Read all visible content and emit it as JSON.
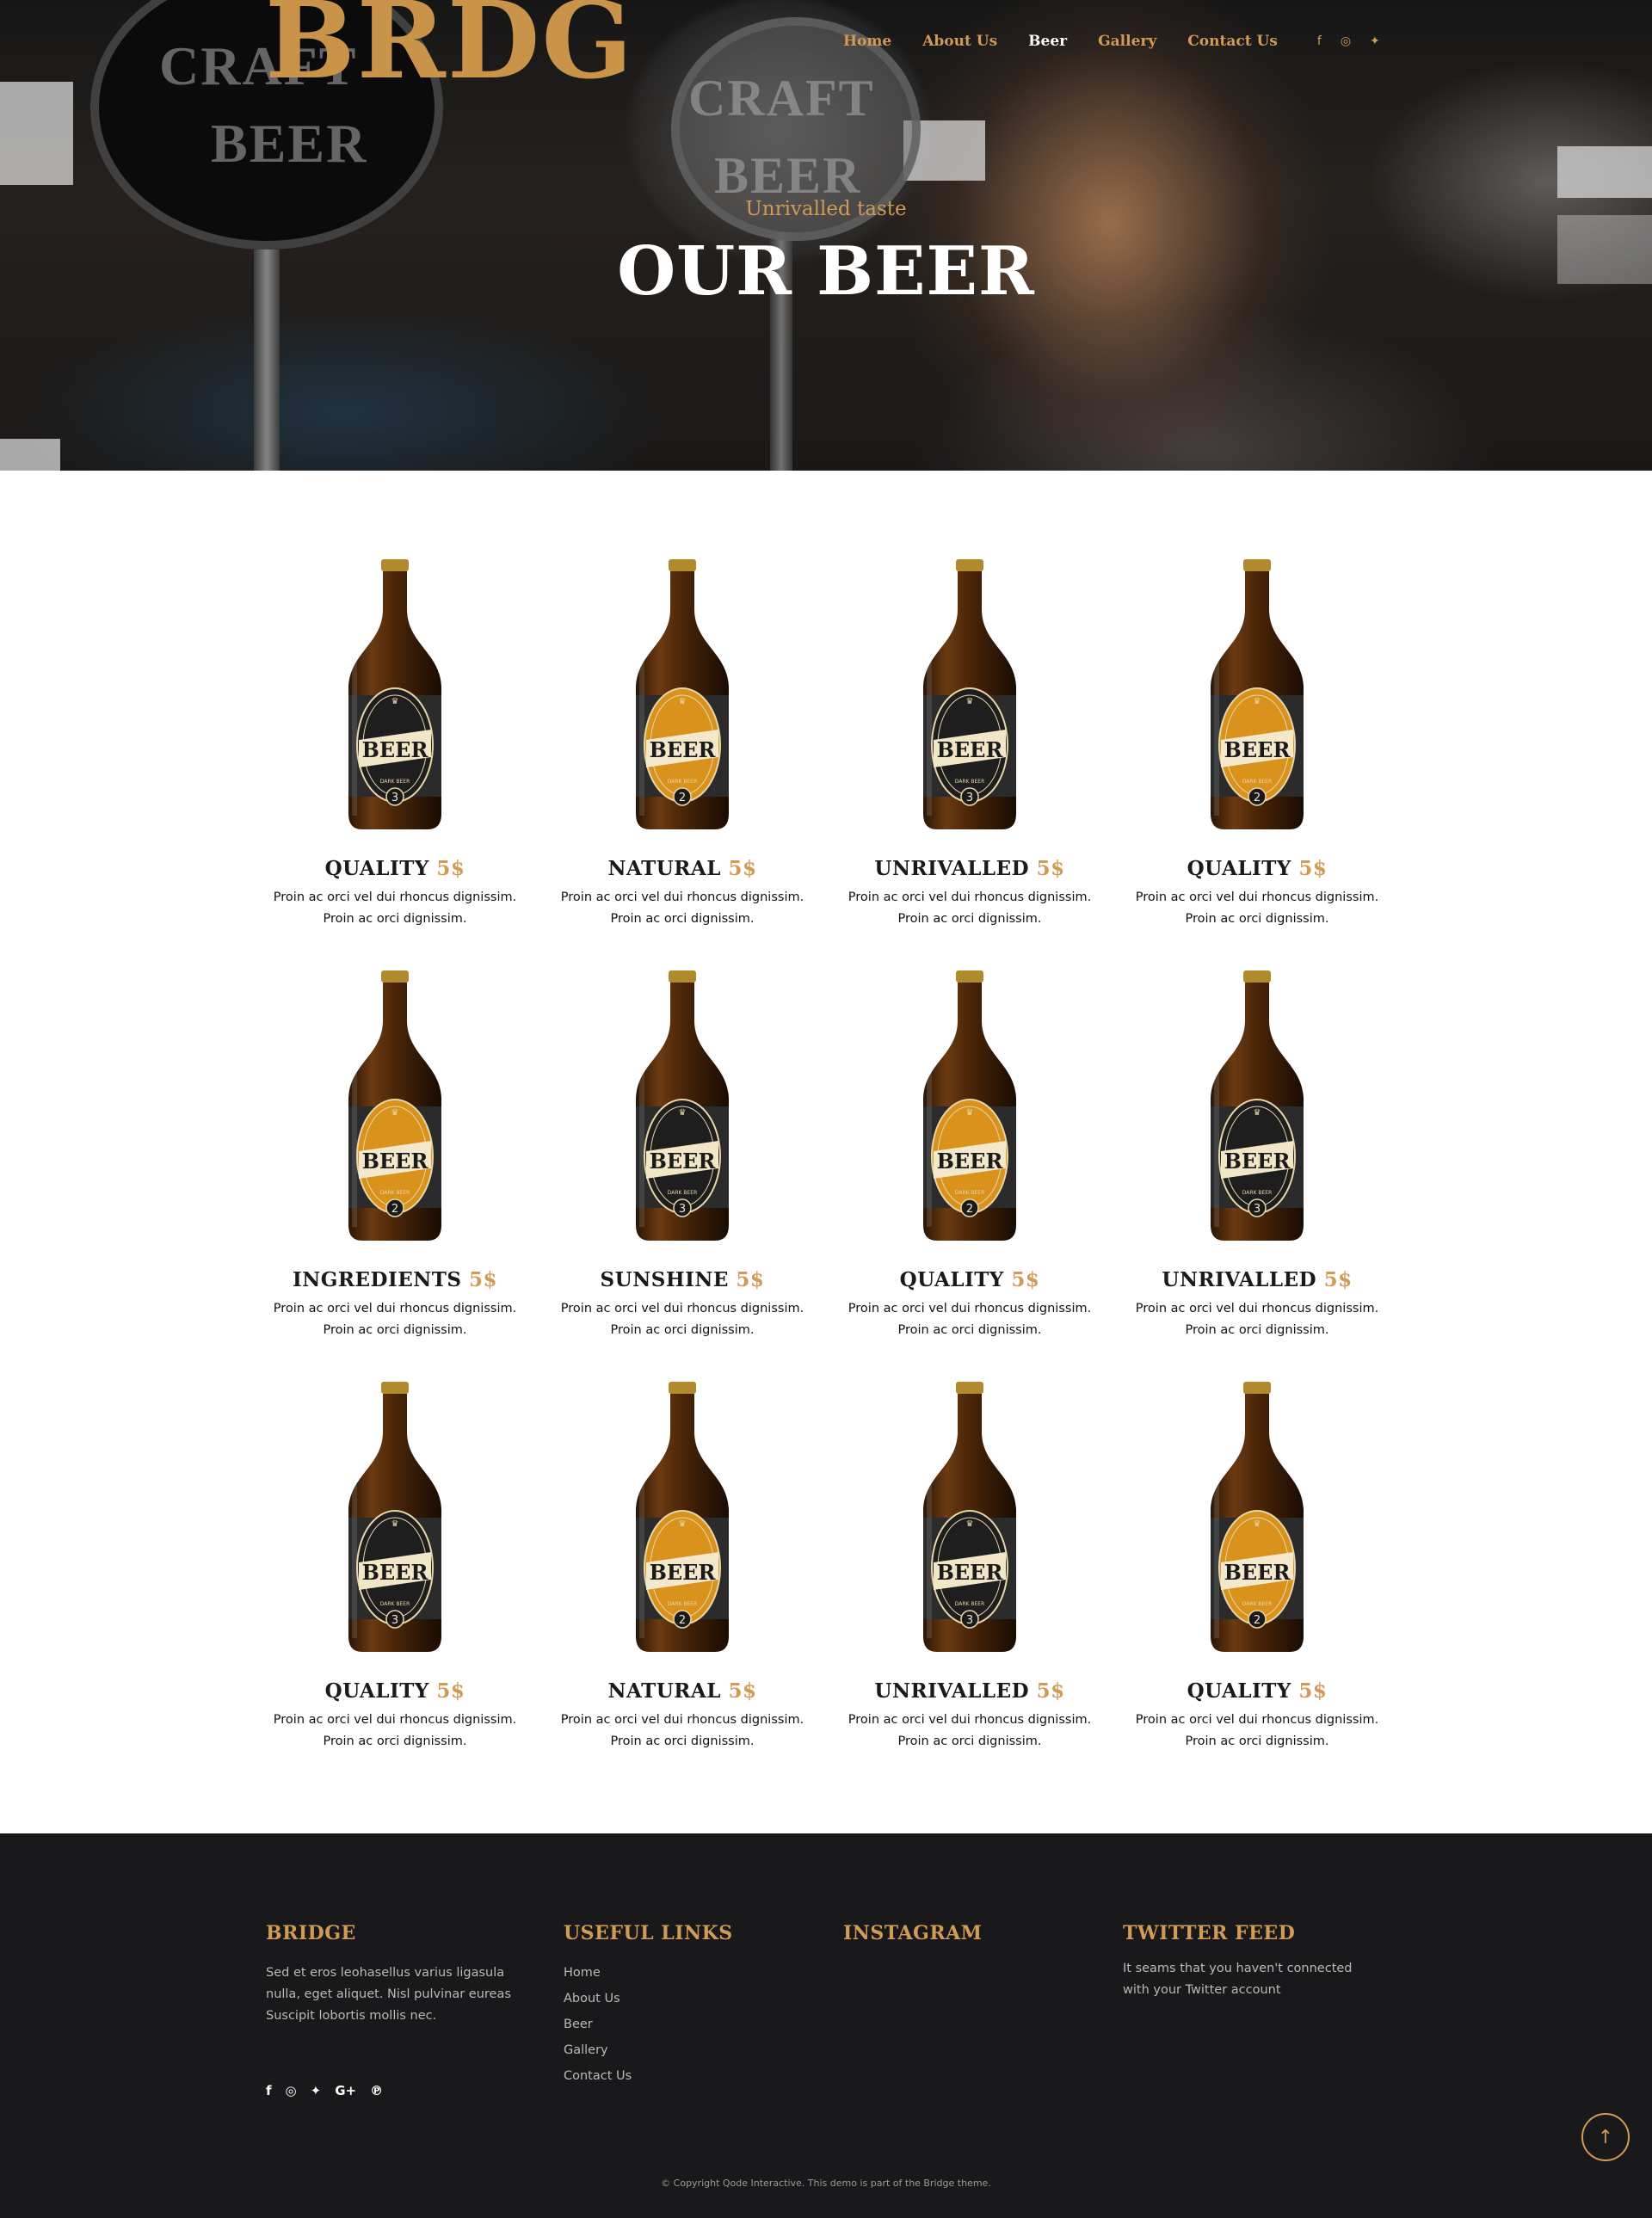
{
  "brand": {
    "logo_text": "BRDG"
  },
  "nav": {
    "items": [
      {
        "label": "Home",
        "active": false
      },
      {
        "label": "About Us",
        "active": false
      },
      {
        "label": "Beer",
        "active": true
      },
      {
        "label": "Gallery",
        "active": false
      },
      {
        "label": "Contact Us",
        "active": false
      }
    ],
    "social_icons": [
      "facebook-icon",
      "instagram-icon",
      "twitter-icon"
    ]
  },
  "hero": {
    "subtitle": "Unrivalled taste",
    "title": "OUR BEER",
    "tap_texts": [
      "CRAFT",
      "BEER"
    ]
  },
  "products": [
    {
      "name": "QUALITY",
      "price": "5$",
      "desc1": "Proin ac orci vel dui rhoncus dignissim.",
      "desc2": "Proin ac orci dignissim.",
      "label": "dark",
      "number": "3"
    },
    {
      "name": "NATURAL",
      "price": "5$",
      "desc1": "Proin ac orci vel dui rhoncus dignissim.",
      "desc2": "Proin ac orci dignissim.",
      "label": "gold",
      "number": "2"
    },
    {
      "name": "UNRIVALLED",
      "price": "5$",
      "desc1": "Proin ac orci vel dui rhoncus dignissim.",
      "desc2": "Proin ac orci dignissim.",
      "label": "dark",
      "number": "3"
    },
    {
      "name": "QUALITY",
      "price": "5$",
      "desc1": "Proin ac orci vel dui rhoncus dignissim.",
      "desc2": "Proin ac orci dignissim.",
      "label": "gold",
      "number": "2"
    },
    {
      "name": "INGREDIENTS",
      "price": "5$",
      "desc1": "Proin ac orci vel dui rhoncus dignissim.",
      "desc2": "Proin ac orci dignissim.",
      "label": "gold",
      "number": "2"
    },
    {
      "name": "SUNSHINE",
      "price": "5$",
      "desc1": "Proin ac orci vel dui rhoncus dignissim.",
      "desc2": "Proin ac orci dignissim.",
      "label": "dark",
      "number": "3"
    },
    {
      "name": "QUALITY",
      "price": "5$",
      "desc1": "Proin ac orci vel dui rhoncus dignissim.",
      "desc2": "Proin ac orci dignissim.",
      "label": "gold",
      "number": "2"
    },
    {
      "name": "UNRIVALLED",
      "price": "5$",
      "desc1": "Proin ac orci vel dui rhoncus dignissim.",
      "desc2": "Proin ac orci dignissim.",
      "label": "dark",
      "number": "3"
    },
    {
      "name": "QUALITY",
      "price": "5$",
      "desc1": "Proin ac orci vel dui rhoncus dignissim.",
      "desc2": "Proin ac orci dignissim.",
      "label": "dark",
      "number": "3"
    },
    {
      "name": "NATURAL",
      "price": "5$",
      "desc1": "Proin ac orci vel dui rhoncus dignissim.",
      "desc2": "Proin ac orci dignissim.",
      "label": "gold",
      "number": "2"
    },
    {
      "name": "UNRIVALLED",
      "price": "5$",
      "desc1": "Proin ac orci vel dui rhoncus dignissim.",
      "desc2": "Proin ac orci dignissim.",
      "label": "dark",
      "number": "3"
    },
    {
      "name": "QUALITY",
      "price": "5$",
      "desc1": "Proin ac orci vel dui rhoncus dignissim.",
      "desc2": "Proin ac orci dignissim.",
      "label": "gold",
      "number": "2"
    }
  ],
  "bottle_label": {
    "word": "BEER",
    "sub": "DARK BEER"
  },
  "footer": {
    "bridge": {
      "title": "BRIDGE",
      "text": "Sed et eros leohasellus varius ligasula nulla, eget aliquet. Nisl pulvinar eureas Suscipit lobortis mollis nec.",
      "social_icons": [
        "facebook-icon",
        "instagram-icon",
        "twitter-icon",
        "google-plus-icon",
        "pinterest-icon"
      ]
    },
    "links": {
      "title": "USEFUL LINKS",
      "items": [
        "Home",
        "About Us",
        "Beer",
        "Gallery",
        "Contact Us"
      ]
    },
    "instagram": {
      "title": "INSTAGRAM"
    },
    "twitter": {
      "title": "TWITTER FEED",
      "text": "It seams that you haven't connected with your Twitter account"
    },
    "copyright": "© Copyright Qode Interactive. This demo is part of the Bridge theme."
  },
  "colors": {
    "accent": "#d19a55",
    "footer_bg": "#19191b",
    "logo": "#c9934a"
  }
}
